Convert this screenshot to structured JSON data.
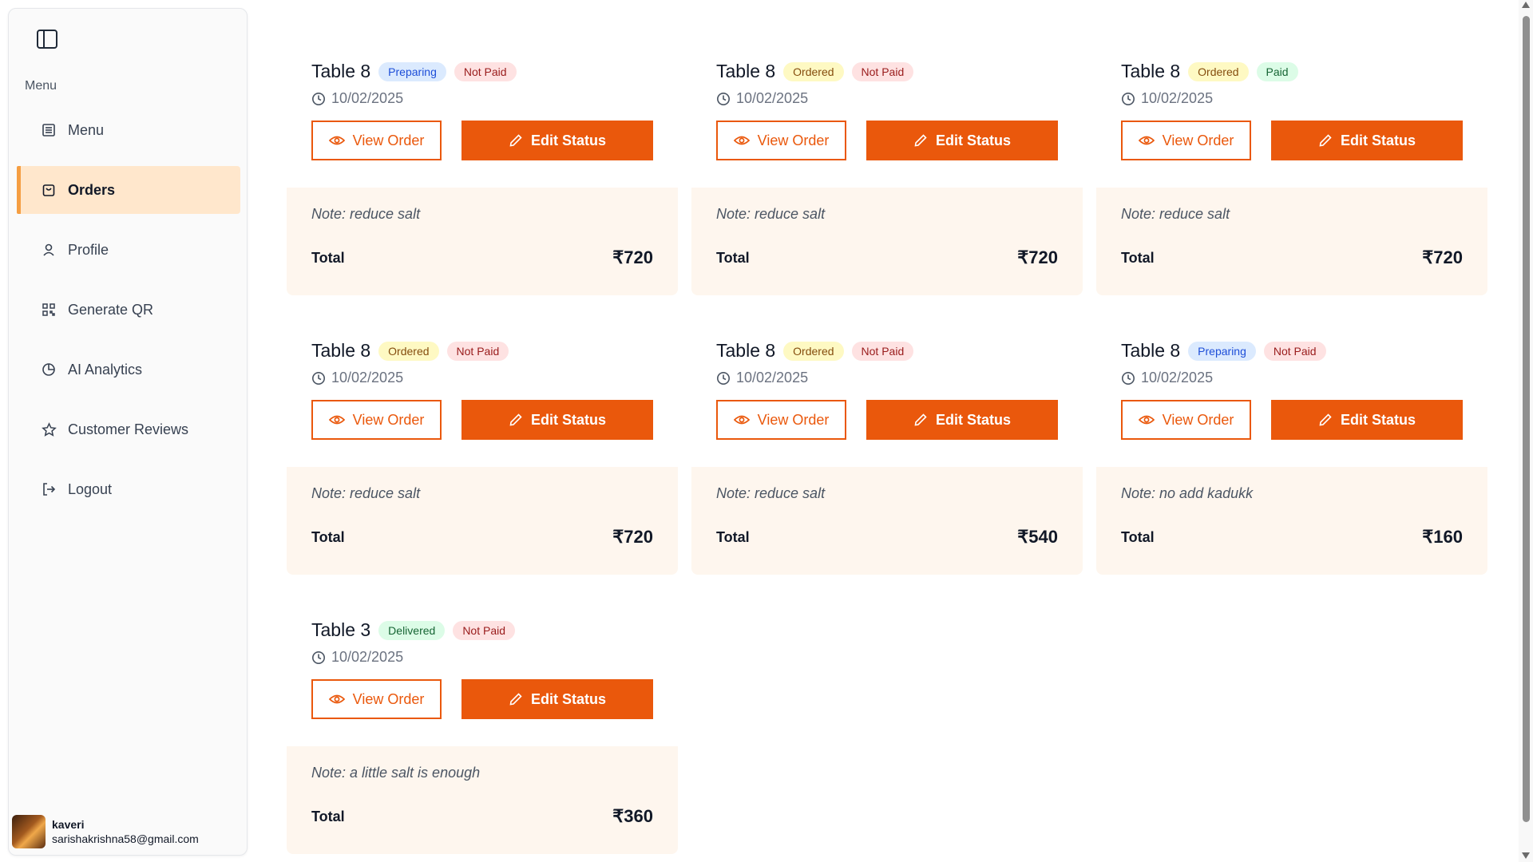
{
  "sidebar": {
    "section_label": "Menu",
    "items": [
      {
        "label": "Menu",
        "icon": "menu-list-icon"
      },
      {
        "label": "Orders",
        "icon": "shopping-bag-icon",
        "active": true
      },
      {
        "label": "Profile",
        "icon": "user-icon"
      },
      {
        "label": "Generate QR",
        "icon": "qr-code-icon"
      },
      {
        "label": "AI Analytics",
        "icon": "pie-chart-icon"
      },
      {
        "label": "Customer Reviews",
        "icon": "star-icon"
      },
      {
        "label": "Logout",
        "icon": "logout-icon"
      }
    ],
    "user": {
      "name": "kaveri",
      "email": "sarishakrishna58@gmail.com"
    }
  },
  "buttons": {
    "view_label": "View Order",
    "edit_label": "Edit Status"
  },
  "total_label": "Total",
  "orders": [
    {
      "table": "Table 8",
      "status": "Preparing",
      "payment": "Not Paid",
      "date": "10/02/2025",
      "note": "Note: reduce salt",
      "total": "₹720"
    },
    {
      "table": "Table 8",
      "status": "Ordered",
      "payment": "Not Paid",
      "date": "10/02/2025",
      "note": "Note: reduce salt",
      "total": "₹720"
    },
    {
      "table": "Table 8",
      "status": "Ordered",
      "payment": "Paid",
      "date": "10/02/2025",
      "note": "Note: reduce salt",
      "total": "₹720"
    },
    {
      "table": "Table 8",
      "status": "Ordered",
      "payment": "Not Paid",
      "date": "10/02/2025",
      "note": "Note: reduce salt",
      "total": "₹720"
    },
    {
      "table": "Table 8",
      "status": "Ordered",
      "payment": "Not Paid",
      "date": "10/02/2025",
      "note": "Note: reduce salt",
      "total": "₹540"
    },
    {
      "table": "Table 8",
      "status": "Preparing",
      "payment": "Not Paid",
      "date": "10/02/2025",
      "note": "Note: no add kadukk",
      "total": "₹160"
    },
    {
      "table": "Table 3",
      "status": "Delivered",
      "payment": "Not Paid",
      "date": "10/02/2025",
      "note": "Note: a little salt is enough",
      "total": "₹360"
    }
  ],
  "colors": {
    "accent": "#ea580c",
    "active_nav_bg": "#ffe7cc",
    "active_nav_bar": "#f59e42",
    "card_footer_bg": "#fef6ee"
  }
}
